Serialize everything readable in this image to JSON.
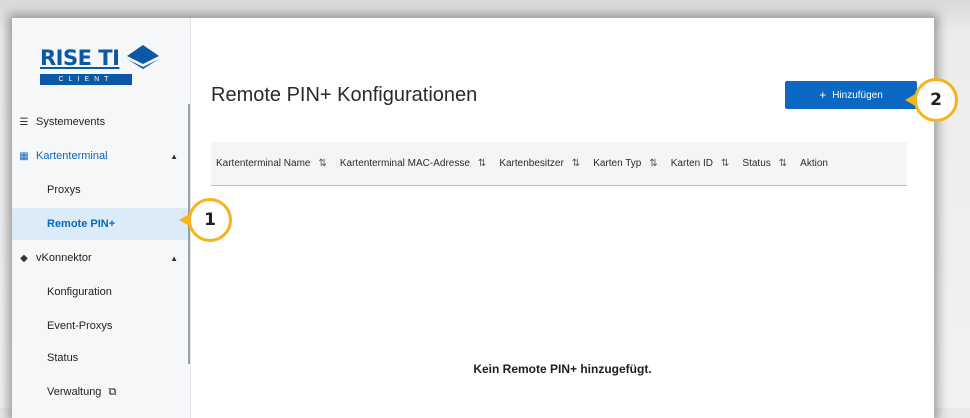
{
  "brand": {
    "name": "RISE TI",
    "sub": "CLIENT",
    "color": "#0a58a6"
  },
  "sidebar": {
    "items": [
      {
        "label": "Systemevents",
        "icon": "list-icon"
      },
      {
        "label": "Kartenterminal",
        "icon": "terminal-icon",
        "expanded": true
      },
      {
        "label": "Proxys"
      },
      {
        "label": "Remote PIN+",
        "active": true
      },
      {
        "label": "vKonnektor",
        "icon": "connector-icon",
        "expanded": true
      },
      {
        "label": "Konfiguration"
      },
      {
        "label": "Event-Proxys"
      },
      {
        "label": "Status"
      },
      {
        "label": "Verwaltung",
        "icon": "external-link-icon"
      }
    ]
  },
  "main": {
    "title": "Remote PIN+ Konfigurationen",
    "add_button": "Hinzufügen",
    "columns": [
      "Kartenterminal Name",
      "Kartenterminal MAC-Adresse",
      "Kartenbesitzer",
      "Karten Typ",
      "Karten ID",
      "Status",
      "Aktion"
    ],
    "empty_text": "Kein Remote PIN+ hinzugefügt."
  },
  "callouts": [
    "1",
    "2"
  ],
  "colors": {
    "accent": "#0a67c2",
    "active_bg": "#dcebf8",
    "callout": "#f5b41e"
  }
}
